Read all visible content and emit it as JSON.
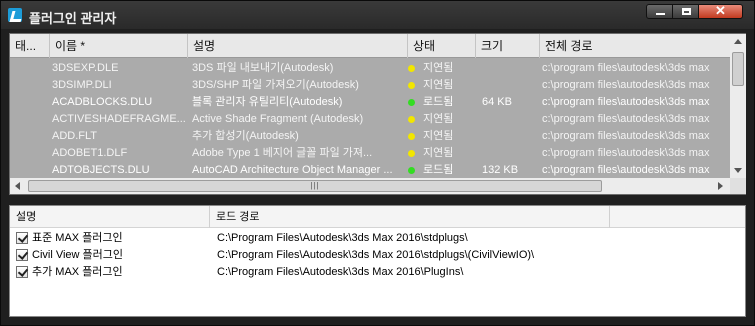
{
  "window": {
    "title": "플러그인 관리자"
  },
  "upper_list": {
    "columns": [
      "태...",
      "이름 *",
      "설명",
      "상태",
      "크기",
      "전체 경로"
    ],
    "rows": [
      {
        "tag": "",
        "name": "3DSEXP.DLE",
        "description": "3DS 파일 내보내기(Autodesk)",
        "status": "지연됨",
        "status_color": "#f2e600",
        "size": "",
        "path": "c:\\program files\\autodesk\\3ds max"
      },
      {
        "tag": "",
        "name": "3DSIMP.DLI",
        "description": "3DS/SHP 파일 가져오기(Autodesk)",
        "status": "지연됨",
        "status_color": "#f2e600",
        "size": "",
        "path": "c:\\program files\\autodesk\\3ds max"
      },
      {
        "tag": "",
        "name": "ACADBLOCKS.DLU",
        "description": "블록 관리자 유틸리티(Autodesk)",
        "status": "로드됨",
        "status_color": "#33dd22",
        "size": "64 KB",
        "path": "c:\\program files\\autodesk\\3ds max"
      },
      {
        "tag": "",
        "name": "ACTIVESHADEFRAGME...",
        "description": "Active Shade Fragment (Autodesk)",
        "status": "지연됨",
        "status_color": "#f2e600",
        "size": "",
        "path": "c:\\program files\\autodesk\\3ds max"
      },
      {
        "tag": "",
        "name": "ADD.FLT",
        "description": "추가 합성기(Autodesk)",
        "status": "지연됨",
        "status_color": "#f2e600",
        "size": "",
        "path": "c:\\program files\\autodesk\\3ds max"
      },
      {
        "tag": "",
        "name": "ADOBET1.DLF",
        "description": "Adobe Type 1 베지어 글꼴 파일 가져...",
        "status": "지연됨",
        "status_color": "#f2e600",
        "size": "",
        "path": "c:\\program files\\autodesk\\3ds max"
      },
      {
        "tag": "",
        "name": "ADTOBJECTS.DLU",
        "description": "AutoCAD Architecture Object Manager ...",
        "status": "로드됨",
        "status_color": "#33dd22",
        "size": "132 KB",
        "path": "c:\\program files\\autodesk\\3ds max"
      }
    ],
    "hscroll_grip": "|||"
  },
  "lower_list": {
    "columns": [
      "설명",
      "로드 경로"
    ],
    "rows": [
      {
        "checked": true,
        "description": "표준 MAX 플러그인",
        "path": "C:\\Program Files\\Autodesk\\3ds Max 2016\\stdplugs\\"
      },
      {
        "checked": true,
        "description": "Civil View 플러그인",
        "path": "C:\\Program Files\\Autodesk\\3ds Max 2016\\stdplugs\\(CivilViewIO)\\"
      },
      {
        "checked": true,
        "description": "추가 MAX 플러그인",
        "path": "C:\\Program Files\\Autodesk\\3ds Max 2016\\PlugIns\\"
      }
    ]
  }
}
